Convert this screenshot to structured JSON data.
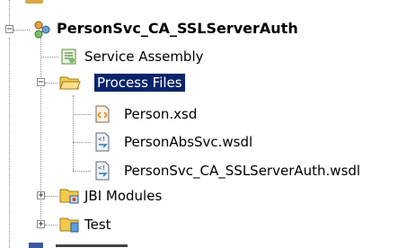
{
  "tree": {
    "project": {
      "label": "PersonSvc_CA_SSLServerAuth",
      "icon": "composite-app-icon",
      "expander": "−"
    },
    "items": [
      {
        "label": "Service Assembly",
        "icon": "service-assembly-icon"
      },
      {
        "label": "Process Files",
        "icon": "open-folder-icon",
        "expander": "−",
        "selected": true
      },
      {
        "label": "Person.xsd",
        "icon": "xsd-file-icon"
      },
      {
        "label": "PersonAbsSvc.wsdl",
        "icon": "wsdl-file-icon"
      },
      {
        "label": "PersonSvc_CA_SSLServerAuth.wsdl",
        "icon": "wsdl-file-icon"
      },
      {
        "label": "JBI Modules",
        "icon": "jbi-folder-icon",
        "expander": "+"
      },
      {
        "label": "Test",
        "icon": "test-folder-icon",
        "expander": "+"
      }
    ]
  },
  "colors": {
    "selection": "#0a246a",
    "connector": "#8a8a8a",
    "folder": "#f2c94c"
  }
}
